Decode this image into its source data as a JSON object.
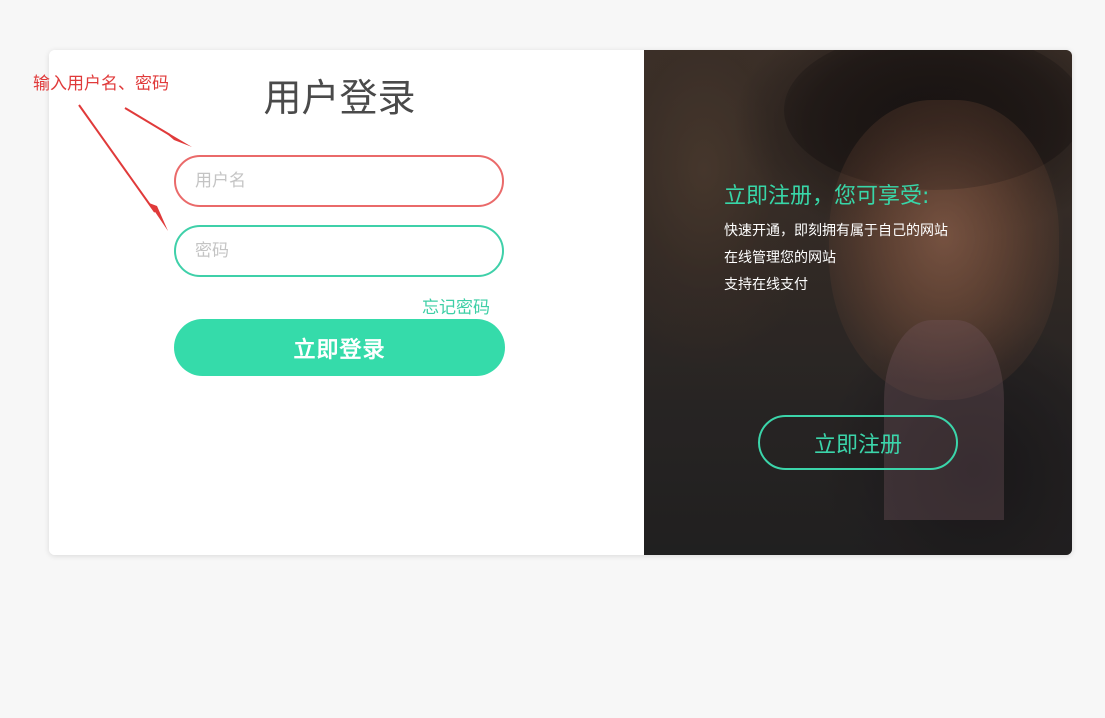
{
  "login": {
    "title": "用户登录",
    "username_placeholder": "用户名",
    "username_value": "",
    "password_placeholder": "密码",
    "password_value": "",
    "forgot_label": "忘记密码",
    "submit_label": "立即登录"
  },
  "promo": {
    "title": "立即注册，您可享受:",
    "lines": [
      "快速开通，即刻拥有属于自己的网站",
      "在线管理您的网站",
      "支持在线支付"
    ],
    "register_label": "立即注册"
  },
  "annotation": {
    "text": "输入用户名、密码",
    "color": "#e03a3a"
  },
  "colors": {
    "accent": "#35dbaa",
    "username_border": "#ea6a6a",
    "password_border": "#3fd0a9",
    "background": "#f7f7f7"
  },
  "icons": {
    "annotation_arrow": "arrow-icon"
  }
}
